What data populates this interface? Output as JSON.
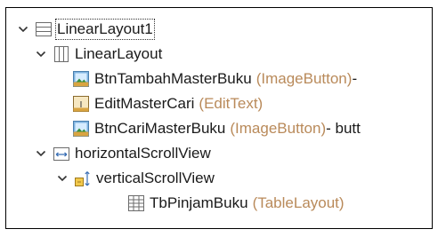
{
  "tree": {
    "nodes": [
      {
        "label": "LinearLayout1",
        "type": "",
        "suffix": "",
        "icon": "linear-layout-vertical-icon",
        "expanded": true
      },
      {
        "label": "LinearLayout",
        "type": "",
        "suffix": "",
        "icon": "linear-layout-horizontal-icon",
        "expanded": true
      },
      {
        "label": "BtnTambahMasterBuku",
        "type": "(ImageButton)",
        "suffix": " -",
        "icon": "image-button-icon"
      },
      {
        "label": "EditMasterCari",
        "type": "(EditText)",
        "suffix": "",
        "icon": "edit-text-icon"
      },
      {
        "label": "BtnCariMasterBuku",
        "type": "(ImageButton)",
        "suffix": " - butt",
        "icon": "image-button-icon"
      },
      {
        "label": "horizontalScrollView",
        "type": "",
        "suffix": "",
        "icon": "horizontal-scroll-view-icon",
        "expanded": true
      },
      {
        "label": "verticalScrollView",
        "type": "",
        "suffix": "",
        "icon": "vertical-scroll-view-icon",
        "expanded": true
      },
      {
        "label": "TbPinjamBuku",
        "type": "(TableLayout)",
        "suffix": "",
        "icon": "table-layout-icon"
      }
    ]
  }
}
